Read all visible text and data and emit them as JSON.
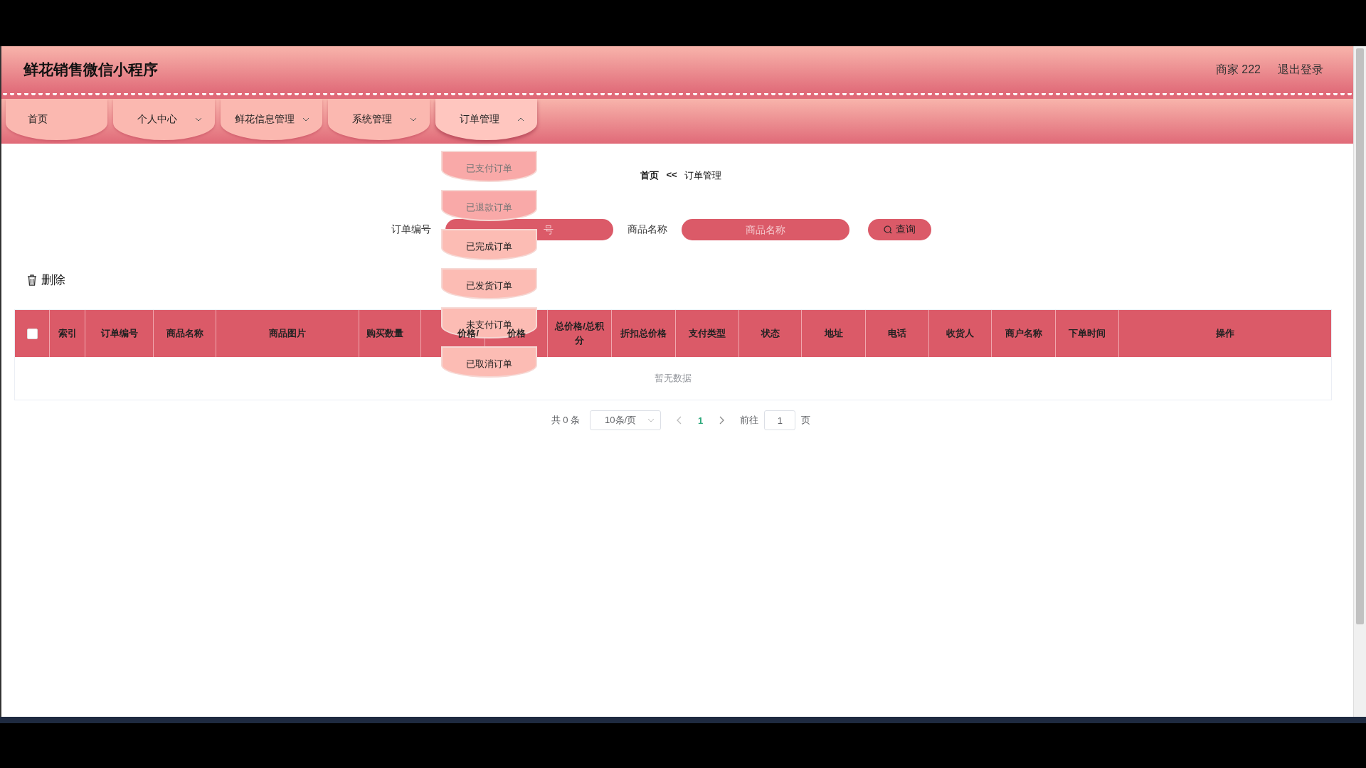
{
  "app": {
    "title": "鲜花销售微信小程序",
    "user": "商家 222",
    "logout": "退出登录"
  },
  "nav": [
    {
      "label": "首页",
      "has_menu": false,
      "expanded": false
    },
    {
      "label": "个人中心",
      "has_menu": true,
      "expanded": false
    },
    {
      "label": "鲜花信息管理",
      "has_menu": true,
      "expanded": false
    },
    {
      "label": "系统管理",
      "has_menu": true,
      "expanded": false
    },
    {
      "label": "订单管理",
      "has_menu": true,
      "expanded": true
    }
  ],
  "dropdown": [
    {
      "label": "已支付订单",
      "faded": true
    },
    {
      "label": "已退款订单",
      "faded": true
    },
    {
      "label": "已完成订单",
      "faded": false
    },
    {
      "label": "已发货订单",
      "faded": false
    },
    {
      "label": "未支付订单",
      "faded": false
    },
    {
      "label": "已取消订单",
      "faded": false
    }
  ],
  "breadcrumb": {
    "home": "首页",
    "separator": "<<",
    "current": "订单管理"
  },
  "search": {
    "fields": [
      {
        "label": "订单编号",
        "placeholder": "号"
      },
      {
        "label": "商品名称",
        "placeholder": "商品名称"
      }
    ],
    "button": "查询"
  },
  "actions": {
    "delete": "删除"
  },
  "table": {
    "select_all_checked": false,
    "columns": [
      {
        "label": "索引"
      },
      {
        "label": "订单编号"
      },
      {
        "label": "商品名称"
      },
      {
        "label": "商品图片"
      },
      {
        "label": "购买数量"
      },
      {
        "label": "价格/"
      },
      {
        "label": "价格"
      },
      {
        "label": "总价格/总积分"
      },
      {
        "label": "折扣总价格"
      },
      {
        "label": "支付类型"
      },
      {
        "label": "状态"
      },
      {
        "label": "地址"
      },
      {
        "label": "电话"
      },
      {
        "label": "收货人"
      },
      {
        "label": "商户名称"
      },
      {
        "label": "下单时间"
      },
      {
        "label": "操作"
      }
    ],
    "empty_text": "暂无数据"
  },
  "pagination": {
    "total": "共 0 条",
    "page_size": "10条/页",
    "pages": [
      {
        "label": "1",
        "selected": true
      }
    ],
    "goto_label": "前往",
    "goto_value": "1",
    "page_unit": "页"
  }
}
